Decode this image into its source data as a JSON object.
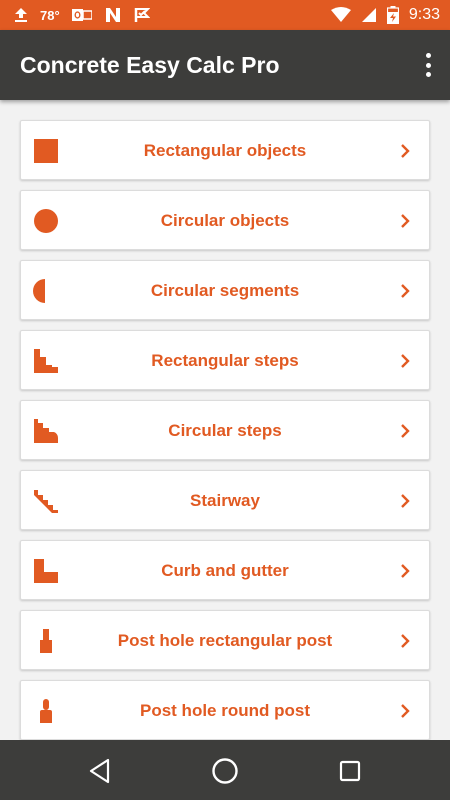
{
  "status_bar": {
    "temperature": "78°",
    "time": "9:33",
    "icons": [
      "upload-icon",
      "outlook-icon",
      "nova-icon",
      "check-flag-icon",
      "wifi-icon",
      "signal-icon",
      "battery-charging-icon"
    ]
  },
  "app_bar": {
    "title": "Concrete Easy Calc Pro",
    "menu_icon": "overflow-menu-icon"
  },
  "menu_items": [
    {
      "label": "Rectangular objects",
      "icon": "rectangle-icon"
    },
    {
      "label": "Circular objects",
      "icon": "circle-icon"
    },
    {
      "label": "Circular segments",
      "icon": "half-circle-icon"
    },
    {
      "label": "Rectangular steps",
      "icon": "rectangular-steps-icon"
    },
    {
      "label": "Circular steps",
      "icon": "circular-steps-icon"
    },
    {
      "label": "Stairway",
      "icon": "stairway-icon"
    },
    {
      "label": "Curb and gutter",
      "icon": "curb-gutter-icon"
    },
    {
      "label": "Post hole rectangular post",
      "icon": "post-rect-icon"
    },
    {
      "label": "Post hole round post",
      "icon": "post-round-icon"
    }
  ],
  "nav_bar": {
    "buttons": [
      "back-icon",
      "home-icon",
      "recents-icon"
    ]
  },
  "colors": {
    "accent": "#e15a22",
    "app_bar": "#3d3d3b",
    "background": "#f2f2f2"
  }
}
